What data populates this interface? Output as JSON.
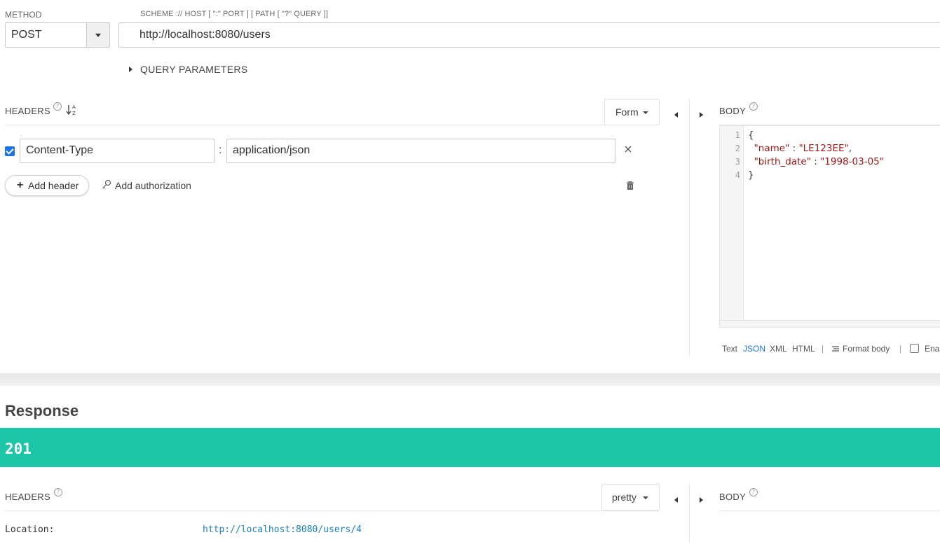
{
  "request": {
    "method_label": "METHOD",
    "method": "POST",
    "url_label": "SCHEME :// HOST [ \":\" PORT ] [ PATH [ \"?\" QUERY ]]",
    "url": "http://localhost:8080/users",
    "query_params_label": "QUERY PARAMETERS"
  },
  "headers_panel": {
    "title": "HEADERS",
    "help": "?",
    "sort_icon_text": "↓A/Z",
    "mode": "Form",
    "rows": [
      {
        "enabled": true,
        "key": "Content-Type",
        "value": "application/json"
      }
    ],
    "separator": ":",
    "add_header_label": "Add header",
    "add_auth_label": "Add authorization"
  },
  "body_panel": {
    "title": "BODY",
    "help": "?",
    "line_numbers": [
      "1",
      "2",
      "3",
      "4"
    ],
    "code": {
      "open": "{",
      "name_key": "\"name\"",
      "name_value": "\"LE123EE\"",
      "birth_key": "\"birth_date\"",
      "birth_value": "\"1998-03-05\"",
      "close": "}",
      "colon": " : ",
      "comma": ","
    },
    "formats": [
      "Text",
      "JSON",
      "XML",
      "HTML"
    ],
    "active_format": "JSON",
    "format_body_label": "Format body",
    "sep": "|",
    "enable_label": "Enal"
  },
  "response": {
    "title": "Response",
    "status_code": "201",
    "status_color": "#1bc5a6",
    "headers_title": "HEADERS",
    "headers_mode": "pretty",
    "body_title": "BODY",
    "headers": [
      {
        "name": "Location:",
        "value": "http://localhost:8080/users/4"
      }
    ]
  },
  "colors": {
    "accent": "#1a73e8",
    "success": "#1bc5a6",
    "link": "#1a7fc1"
  }
}
